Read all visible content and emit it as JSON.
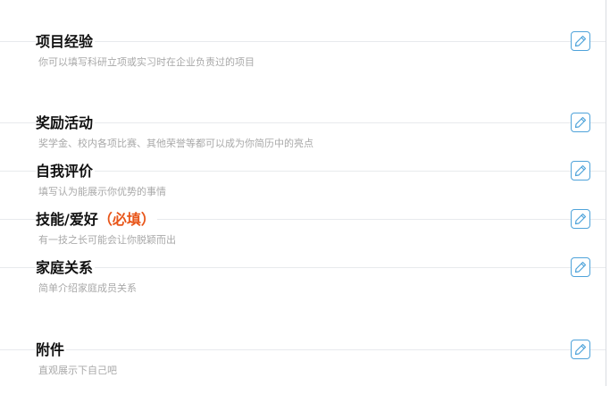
{
  "sections": [
    {
      "title": "项目经验",
      "hint": "你可以填写科研立项或实习时在企业负责过的项目",
      "edit_icon": "pencil-square-icon"
    },
    {
      "title": "奖励活动",
      "hint": "奖学金、校内各项比赛、其他荣誉等都可以成为你简历中的亮点",
      "edit_icon": "pencil-square-icon"
    },
    {
      "title": "自我评价",
      "hint": "填写认为能展示你优势的事情",
      "edit_icon": "pencil-square-icon"
    },
    {
      "title": "技能/爱好",
      "required_tag": "（必填）",
      "hint": "有一技之长可能会让你脱颖而出",
      "edit_icon": "pencil-square-icon"
    },
    {
      "title": "家庭关系",
      "hint": "简单介绍家庭成员关系",
      "edit_icon": "pencil-square-icon"
    },
    {
      "title": "附件",
      "hint": "直观展示下自己吧",
      "edit_icon": "pencil-square-icon"
    }
  ],
  "colors": {
    "title": "#111111",
    "hint": "#a9a9a9",
    "required": "#e8561a",
    "icon": "#4fa3da",
    "divider": "#e8eaed"
  }
}
